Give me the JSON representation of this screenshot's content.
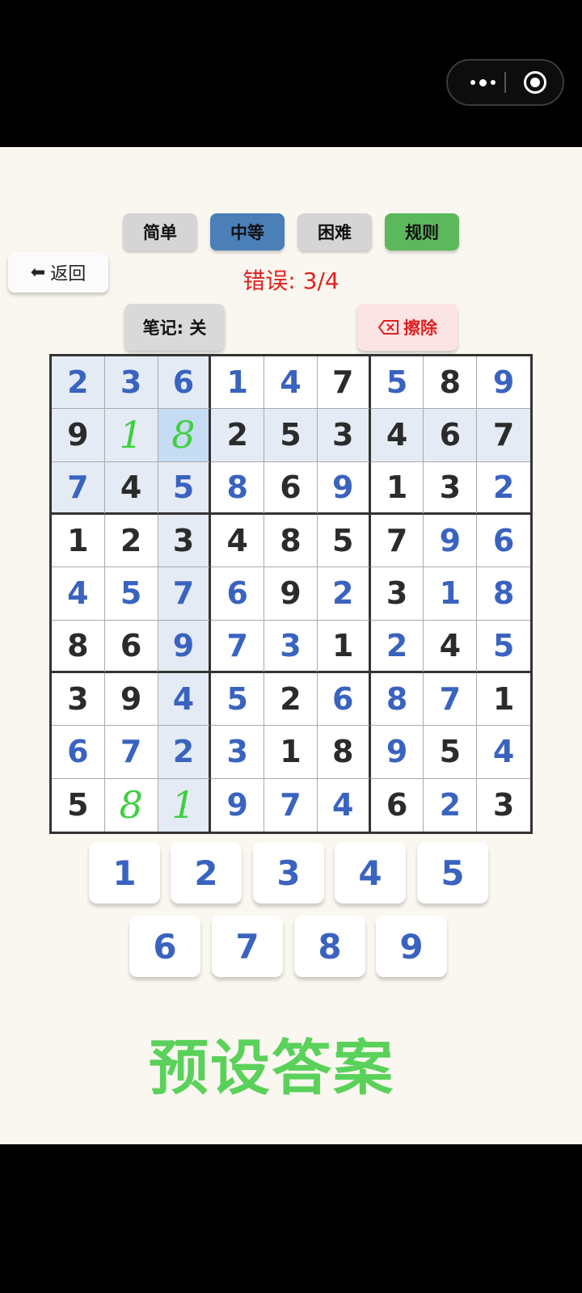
{
  "difficulty": {
    "easy": "简单",
    "medium": "中等",
    "hard": "困难",
    "rules": "规则"
  },
  "colors": {
    "easy": "#d5d5d5",
    "medium": "#4a7fb8",
    "hard": "#d5d5d5",
    "rules": "#5cb85c",
    "given_digit": "#2b2b2b",
    "user_digit": "#3a63c0",
    "note_digit": "#3fcf3f",
    "error_text": "#e02020"
  },
  "back": {
    "label": "返回",
    "icon": "arrow-left-icon"
  },
  "errors": {
    "text": "错误: 3/4"
  },
  "notes": {
    "label": "笔记: 关"
  },
  "erase": {
    "label": "擦除",
    "icon": "backspace-icon"
  },
  "board": {
    "rows": [
      [
        {
          "v": "2",
          "t": "user"
        },
        {
          "v": "3",
          "t": "user"
        },
        {
          "v": "6",
          "t": "user"
        },
        {
          "v": "1",
          "t": "user"
        },
        {
          "v": "4",
          "t": "user"
        },
        {
          "v": "7",
          "t": "given"
        },
        {
          "v": "5",
          "t": "user"
        },
        {
          "v": "8",
          "t": "given"
        },
        {
          "v": "9",
          "t": "user"
        }
      ],
      [
        {
          "v": "9",
          "t": "given"
        },
        {
          "v": "1",
          "t": "note"
        },
        {
          "v": "8",
          "t": "note"
        },
        {
          "v": "2",
          "t": "given"
        },
        {
          "v": "5",
          "t": "given"
        },
        {
          "v": "3",
          "t": "given"
        },
        {
          "v": "4",
          "t": "given"
        },
        {
          "v": "6",
          "t": "given"
        },
        {
          "v": "7",
          "t": "given"
        }
      ],
      [
        {
          "v": "7",
          "t": "user"
        },
        {
          "v": "4",
          "t": "given"
        },
        {
          "v": "5",
          "t": "user"
        },
        {
          "v": "8",
          "t": "user"
        },
        {
          "v": "6",
          "t": "given"
        },
        {
          "v": "9",
          "t": "user"
        },
        {
          "v": "1",
          "t": "given"
        },
        {
          "v": "3",
          "t": "given"
        },
        {
          "v": "2",
          "t": "user"
        }
      ],
      [
        {
          "v": "1",
          "t": "given"
        },
        {
          "v": "2",
          "t": "given"
        },
        {
          "v": "3",
          "t": "given"
        },
        {
          "v": "4",
          "t": "given"
        },
        {
          "v": "8",
          "t": "given"
        },
        {
          "v": "5",
          "t": "given"
        },
        {
          "v": "7",
          "t": "given"
        },
        {
          "v": "9",
          "t": "user"
        },
        {
          "v": "6",
          "t": "user"
        }
      ],
      [
        {
          "v": "4",
          "t": "user"
        },
        {
          "v": "5",
          "t": "user"
        },
        {
          "v": "7",
          "t": "user"
        },
        {
          "v": "6",
          "t": "user"
        },
        {
          "v": "9",
          "t": "given"
        },
        {
          "v": "2",
          "t": "user"
        },
        {
          "v": "3",
          "t": "given"
        },
        {
          "v": "1",
          "t": "user"
        },
        {
          "v": "8",
          "t": "user"
        }
      ],
      [
        {
          "v": "8",
          "t": "given"
        },
        {
          "v": "6",
          "t": "given"
        },
        {
          "v": "9",
          "t": "user"
        },
        {
          "v": "7",
          "t": "user"
        },
        {
          "v": "3",
          "t": "user"
        },
        {
          "v": "1",
          "t": "given"
        },
        {
          "v": "2",
          "t": "user"
        },
        {
          "v": "4",
          "t": "given"
        },
        {
          "v": "5",
          "t": "user"
        }
      ],
      [
        {
          "v": "3",
          "t": "given"
        },
        {
          "v": "9",
          "t": "given"
        },
        {
          "v": "4",
          "t": "user"
        },
        {
          "v": "5",
          "t": "user"
        },
        {
          "v": "2",
          "t": "given"
        },
        {
          "v": "6",
          "t": "user"
        },
        {
          "v": "8",
          "t": "user"
        },
        {
          "v": "7",
          "t": "user"
        },
        {
          "v": "1",
          "t": "given"
        }
      ],
      [
        {
          "v": "6",
          "t": "user"
        },
        {
          "v": "7",
          "t": "user"
        },
        {
          "v": "2",
          "t": "user"
        },
        {
          "v": "3",
          "t": "user"
        },
        {
          "v": "1",
          "t": "given"
        },
        {
          "v": "8",
          "t": "given"
        },
        {
          "v": "9",
          "t": "user"
        },
        {
          "v": "5",
          "t": "given"
        },
        {
          "v": "4",
          "t": "user"
        }
      ],
      [
        {
          "v": "5",
          "t": "given"
        },
        {
          "v": "8",
          "t": "note"
        },
        {
          "v": "1",
          "t": "note"
        },
        {
          "v": "9",
          "t": "user"
        },
        {
          "v": "7",
          "t": "user"
        },
        {
          "v": "4",
          "t": "user"
        },
        {
          "v": "6",
          "t": "given"
        },
        {
          "v": "2",
          "t": "user"
        },
        {
          "v": "3",
          "t": "given"
        }
      ]
    ],
    "selected": {
      "row": 1,
      "col": 2
    }
  },
  "numpad": [
    "1",
    "2",
    "3",
    "4",
    "5",
    "6",
    "7",
    "8",
    "9"
  ],
  "footer": {
    "text": "预设答案"
  }
}
